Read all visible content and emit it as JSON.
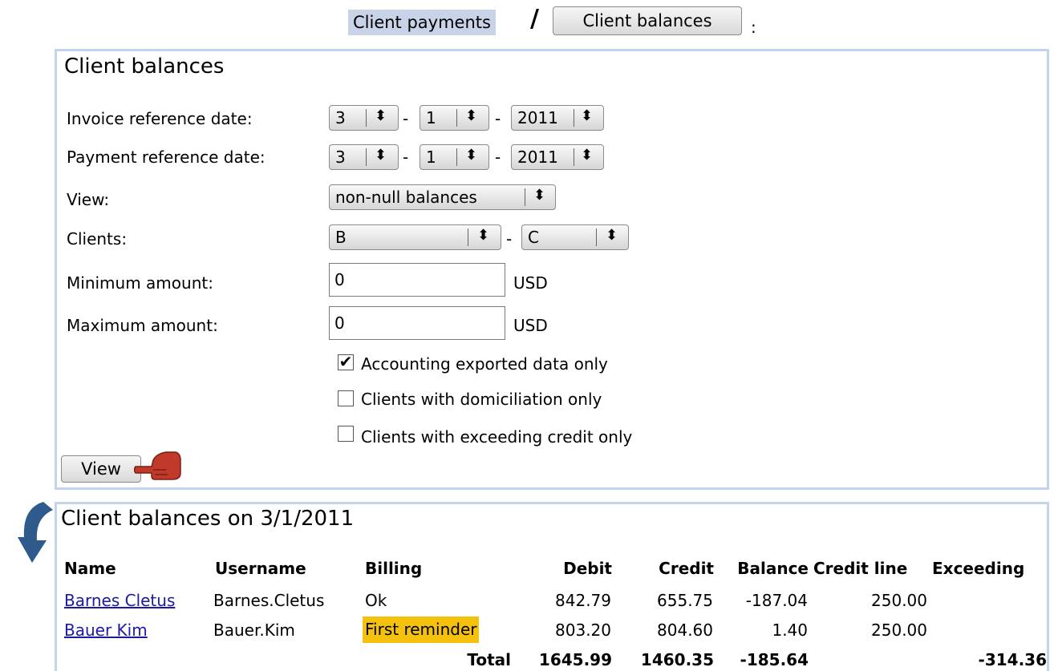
{
  "nav": {
    "tab_payments": "Client payments",
    "separator": "/",
    "tab_balances": "Client balances",
    "trailing": ":"
  },
  "filter": {
    "title": "Client balances",
    "invoice_label": "Invoice reference date:",
    "invoice_day": "3",
    "invoice_month": "1",
    "invoice_year": "2011",
    "payment_label": "Payment reference date:",
    "payment_day": "3",
    "payment_month": "1",
    "payment_year": "2011",
    "dash": "-",
    "view_label": "View:",
    "view_value": "non-null balances",
    "clients_label": "Clients:",
    "clients_from": "B",
    "clients_to": "C",
    "min_label": "Minimum amount:",
    "min_value": "0",
    "max_label": "Maximum amount:",
    "max_value": "0",
    "currency": "USD",
    "opt_accounting": "Accounting exported data only",
    "opt_domiciliation": "Clients with domiciliation only",
    "opt_exceeding": "Clients with exceeding credit only",
    "opt_accounting_checked": true,
    "view_button": "View",
    "arrow_symbol": "⇕"
  },
  "results": {
    "title": "Client balances on 3/1/2011",
    "headers": {
      "name": "Name",
      "username": "Username",
      "billing": "Billing",
      "debit": "Debit",
      "credit": "Credit",
      "balance": "Balance",
      "credit_line": "Credit line",
      "exceeding": "Exceeding"
    },
    "rows": [
      {
        "name": "Barnes Cletus",
        "username": "Barnes.Cletus",
        "billing": "Ok",
        "debit": "842.79",
        "credit": "655.75",
        "balance": "-187.04",
        "credit_line": "250.00",
        "exceeding": ""
      },
      {
        "name": "Bauer Kim",
        "username": "Bauer.Kim",
        "billing": "First reminder",
        "debit": "803.20",
        "credit": "804.60",
        "balance": "1.40",
        "credit_line": "250.00",
        "exceeding": ""
      }
    ],
    "total": {
      "label": "Total",
      "debit": "1645.99",
      "credit": "1460.35",
      "balance": "-185.64",
      "exceeding": "-314.36"
    }
  },
  "colors": {
    "panel_border": "#c3d4ea",
    "active_tab": "#c9d3e8",
    "reminder_highlight": "#f4c20d",
    "link": "#1a1aa6",
    "arrow": "#2e5a8c",
    "hand": "#c0392b"
  },
  "icons": {
    "pointer": "pointing-hand-icon",
    "result_arrow": "curved-arrow-icon",
    "select_arrows": "updown-arrows-icon",
    "checkmark": "checkmark-icon"
  }
}
